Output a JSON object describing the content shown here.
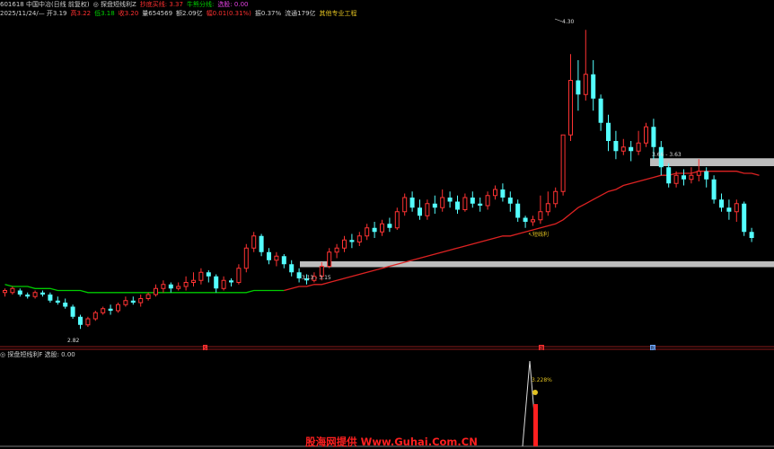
{
  "header": {
    "line1": [
      {
        "text": "601618 中国中冶(日线 前复权)",
        "color": "#d0d0d0"
      },
      {
        "text": "◎ 探盘短线利Z",
        "color": "#d0d0d0"
      },
      {
        "text": "抄底买线: 3.37",
        "color": "#ff3030"
      },
      {
        "text": "牛熊分线:",
        "color": "#00d000"
      },
      {
        "text": "选股: 0.00",
        "color": "#e040e0"
      }
    ],
    "line2": [
      {
        "text": "2025/11/24/— 开3.19",
        "color": "#d0d0d0"
      },
      {
        "text": "高3.22",
        "color": "#ff3030"
      },
      {
        "text": "低3.18",
        "color": "#00d000"
      },
      {
        "text": "收3.20",
        "color": "#ff3030"
      },
      {
        "text": "量654569",
        "color": "#d0d0d0"
      },
      {
        "text": "额2.09亿",
        "color": "#d0d0d0"
      },
      {
        "text": "幅0.01(0.31%)",
        "color": "#ff3030"
      },
      {
        "text": "振0.37%",
        "color": "#d0d0d0"
      },
      {
        "text": "流通179亿",
        "color": "#d0d0d0"
      },
      {
        "text": "其他专业工程",
        "color": "#e0c020"
      }
    ]
  },
  "subpanel": {
    "title": "◎ 探盘短线利F",
    "value": "选股: 0.00",
    "peak_label": "3.228%"
  },
  "annotations": {
    "high": "4.30",
    "low": "2.82",
    "support": "3.13 - 3.15",
    "resistance": "3.66 - 3.63",
    "buy_signal": "↖短线利"
  },
  "markers": {
    "m1": "S",
    "m2": "涨",
    "m3": "利"
  },
  "watermark": "股海网提供 Www.Guhai.Com.CN",
  "colors": {
    "up": "#ff3333",
    "down": "#54ffff",
    "ma_before": "#00cc00",
    "ma_after": "#dd2222",
    "band": "#bdbdbd",
    "watermark": "#ff2020"
  },
  "chart_data": {
    "type": "candlestick",
    "ylim": [
      2.75,
      4.35
    ],
    "bars": [
      [
        3.0,
        3.01,
        2.98,
        3.02
      ],
      [
        3.0,
        3.02,
        2.99,
        3.03
      ],
      [
        3.01,
        2.99,
        2.98,
        3.02
      ],
      [
        2.99,
        2.98,
        2.97,
        3.0
      ],
      [
        2.98,
        3.0,
        2.97,
        3.01
      ],
      [
        3.0,
        2.99,
        2.98,
        3.01
      ],
      [
        2.99,
        2.96,
        2.95,
        3.0
      ],
      [
        2.96,
        2.95,
        2.94,
        2.98
      ],
      [
        2.95,
        2.93,
        2.92,
        2.97
      ],
      [
        2.93,
        2.88,
        2.87,
        2.94
      ],
      [
        2.88,
        2.84,
        2.82,
        2.89
      ],
      [
        2.84,
        2.87,
        2.83,
        2.88
      ],
      [
        2.87,
        2.9,
        2.86,
        2.91
      ],
      [
        2.9,
        2.92,
        2.89,
        2.93
      ],
      [
        2.92,
        2.91,
        2.89,
        2.94
      ],
      [
        2.91,
        2.94,
        2.9,
        2.95
      ],
      [
        2.94,
        2.96,
        2.93,
        2.98
      ],
      [
        2.96,
        2.95,
        2.94,
        2.98
      ],
      [
        2.95,
        2.97,
        2.93,
        2.99
      ],
      [
        2.97,
        2.99,
        2.96,
        3.0
      ],
      [
        2.99,
        3.02,
        2.98,
        3.04
      ],
      [
        3.02,
        3.04,
        3.0,
        3.06
      ],
      [
        3.04,
        3.02,
        3.0,
        3.05
      ],
      [
        3.02,
        3.03,
        3.01,
        3.05
      ],
      [
        3.03,
        3.05,
        3.01,
        3.08
      ],
      [
        3.05,
        3.06,
        3.03,
        3.1
      ],
      [
        3.06,
        3.1,
        3.04,
        3.12
      ],
      [
        3.1,
        3.08,
        3.05,
        3.11
      ],
      [
        3.08,
        3.02,
        3.0,
        3.09
      ],
      [
        3.02,
        3.06,
        3.01,
        3.08
      ],
      [
        3.06,
        3.05,
        3.03,
        3.07
      ],
      [
        3.05,
        3.12,
        3.04,
        3.14
      ],
      [
        3.12,
        3.22,
        3.1,
        3.24
      ],
      [
        3.22,
        3.28,
        3.2,
        3.3
      ],
      [
        3.28,
        3.2,
        3.18,
        3.29
      ],
      [
        3.2,
        3.16,
        3.14,
        3.22
      ],
      [
        3.16,
        3.18,
        3.13,
        3.2
      ],
      [
        3.18,
        3.14,
        3.12,
        3.19
      ],
      [
        3.14,
        3.1,
        3.08,
        3.16
      ],
      [
        3.1,
        3.07,
        3.05,
        3.12
      ],
      [
        3.07,
        3.06,
        3.04,
        3.09
      ],
      [
        3.06,
        3.08,
        3.05,
        3.1
      ],
      [
        3.08,
        3.13,
        3.06,
        3.15
      ],
      [
        3.13,
        3.2,
        3.12,
        3.22
      ],
      [
        3.2,
        3.22,
        3.17,
        3.24
      ],
      [
        3.22,
        3.26,
        3.2,
        3.28
      ],
      [
        3.26,
        3.25,
        3.22,
        3.29
      ],
      [
        3.25,
        3.28,
        3.23,
        3.3
      ],
      [
        3.28,
        3.32,
        3.26,
        3.34
      ],
      [
        3.32,
        3.3,
        3.27,
        3.35
      ],
      [
        3.3,
        3.34,
        3.28,
        3.36
      ],
      [
        3.34,
        3.32,
        3.3,
        3.37
      ],
      [
        3.32,
        3.4,
        3.31,
        3.42
      ],
      [
        3.4,
        3.47,
        3.38,
        3.49
      ],
      [
        3.47,
        3.42,
        3.4,
        3.5
      ],
      [
        3.42,
        3.38,
        3.36,
        3.46
      ],
      [
        3.38,
        3.44,
        3.36,
        3.46
      ],
      [
        3.44,
        3.42,
        3.39,
        3.48
      ],
      [
        3.42,
        3.47,
        3.4,
        3.51
      ],
      [
        3.47,
        3.45,
        3.42,
        3.5
      ],
      [
        3.45,
        3.41,
        3.39,
        3.48
      ],
      [
        3.41,
        3.47,
        3.4,
        3.49
      ],
      [
        3.47,
        3.44,
        3.42,
        3.5
      ],
      [
        3.44,
        3.43,
        3.4,
        3.47
      ],
      [
        3.43,
        3.48,
        3.41,
        3.5
      ],
      [
        3.48,
        3.51,
        3.46,
        3.53
      ],
      [
        3.51,
        3.47,
        3.45,
        3.54
      ],
      [
        3.47,
        3.44,
        3.4,
        3.5
      ],
      [
        3.44,
        3.37,
        3.35,
        3.46
      ],
      [
        3.37,
        3.35,
        3.32,
        3.38
      ],
      [
        3.35,
        3.36,
        3.33,
        3.38
      ],
      [
        3.36,
        3.4,
        3.34,
        3.48
      ],
      [
        3.4,
        3.44,
        3.38,
        3.5
      ],
      [
        3.44,
        3.5,
        3.42,
        3.52
      ],
      [
        3.5,
        3.78,
        3.48,
        3.78
      ],
      [
        3.78,
        4.05,
        3.75,
        4.18
      ],
      [
        4.05,
        3.98,
        3.9,
        4.15
      ],
      [
        3.98,
        4.08,
        3.95,
        4.3
      ],
      [
        4.08,
        3.96,
        3.9,
        4.15
      ],
      [
        3.96,
        3.84,
        3.8,
        3.98
      ],
      [
        3.84,
        3.75,
        3.7,
        3.88
      ],
      [
        3.75,
        3.7,
        3.66,
        3.8
      ],
      [
        3.7,
        3.72,
        3.68,
        3.76
      ],
      [
        3.72,
        3.7,
        3.65,
        3.75
      ],
      [
        3.7,
        3.74,
        3.68,
        3.8
      ],
      [
        3.74,
        3.82,
        3.72,
        3.84
      ],
      [
        3.82,
        3.72,
        3.66,
        3.86
      ],
      [
        3.72,
        3.62,
        3.58,
        3.75
      ],
      [
        3.62,
        3.54,
        3.52,
        3.64
      ],
      [
        3.54,
        3.58,
        3.52,
        3.6
      ],
      [
        3.58,
        3.56,
        3.53,
        3.61
      ],
      [
        3.56,
        3.58,
        3.54,
        3.62
      ],
      [
        3.58,
        3.6,
        3.55,
        3.66
      ],
      [
        3.6,
        3.56,
        3.52,
        3.62
      ],
      [
        3.56,
        3.46,
        3.44,
        3.58
      ],
      [
        3.46,
        3.42,
        3.4,
        3.49
      ],
      [
        3.42,
        3.4,
        3.36,
        3.46
      ],
      [
        3.4,
        3.44,
        3.35,
        3.46
      ],
      [
        3.44,
        3.3,
        3.28,
        3.45
      ],
      [
        3.3,
        3.27,
        3.25,
        3.32
      ]
    ],
    "ma_split_index": 37,
    "ma": [
      3.04,
      3.03,
      3.03,
      3.03,
      3.02,
      3.02,
      3.02,
      3.01,
      3.01,
      3.01,
      3.01,
      3.0,
      3.0,
      3.0,
      3.0,
      3.0,
      3.0,
      3.0,
      3.0,
      3.0,
      3.0,
      3.0,
      3.0,
      3.0,
      3.0,
      3.0,
      3.0,
      3.0,
      3.0,
      3.0,
      3.0,
      3.0,
      3.0,
      3.01,
      3.01,
      3.01,
      3.01,
      3.01,
      3.02,
      3.03,
      3.03,
      3.04,
      3.04,
      3.05,
      3.06,
      3.07,
      3.08,
      3.09,
      3.1,
      3.11,
      3.12,
      3.13,
      3.14,
      3.15,
      3.16,
      3.17,
      3.18,
      3.19,
      3.2,
      3.21,
      3.22,
      3.23,
      3.24,
      3.25,
      3.26,
      3.27,
      3.28,
      3.28,
      3.29,
      3.3,
      3.31,
      3.32,
      3.33,
      3.34,
      3.36,
      3.39,
      3.42,
      3.44,
      3.46,
      3.48,
      3.5,
      3.51,
      3.53,
      3.54,
      3.55,
      3.56,
      3.57,
      3.58,
      3.58,
      3.59,
      3.59,
      3.59,
      3.6,
      3.6,
      3.6,
      3.6,
      3.6,
      3.6,
      3.59,
      3.59,
      3.58
    ],
    "support_band": [
      3.13,
      3.15
    ],
    "resistance_band": [
      3.63,
      3.66
    ]
  }
}
